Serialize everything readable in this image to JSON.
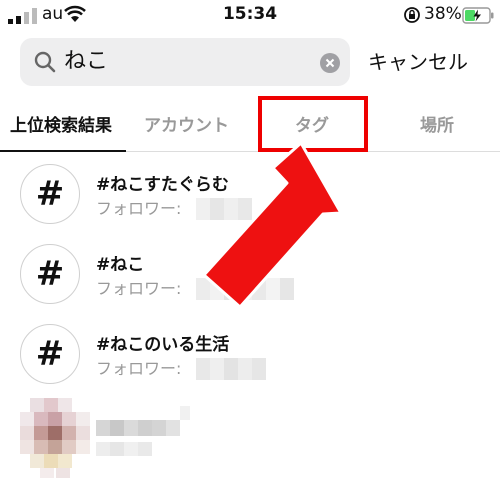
{
  "status_bar": {
    "carrier": "au",
    "time": "15:34",
    "battery": "38%"
  },
  "search": {
    "query": "ねこ",
    "cancel_label": "キャンセル"
  },
  "tabs": [
    {
      "label": "上位検索結果",
      "selected": true
    },
    {
      "label": "アカウント",
      "selected": false
    },
    {
      "label": "タグ",
      "selected": false,
      "highlighted": true
    },
    {
      "label": "場所",
      "selected": false
    }
  ],
  "results": [
    {
      "icon": "#",
      "title": "#ねこすたぐらむ",
      "subtitle": "フォロワー:"
    },
    {
      "icon": "#",
      "title": "#ねこ",
      "subtitle": "フォロワー:"
    },
    {
      "icon": "#",
      "title": "#ねこのいる生活",
      "subtitle": "フォロワー:"
    }
  ],
  "colors": {
    "highlight": "#e00000",
    "arrow": "#ee1111",
    "muted_text": "#999999",
    "search_bg": "#eeeeef",
    "battery": "#4cd964"
  },
  "icons": {
    "signal": "signal-icon",
    "wifi": "wifi-icon",
    "orientation_lock": "rotation-lock-icon",
    "battery": "battery-charging-icon",
    "search": "search-icon",
    "clear": "clear-icon",
    "hashtag": "hashtag-icon"
  }
}
